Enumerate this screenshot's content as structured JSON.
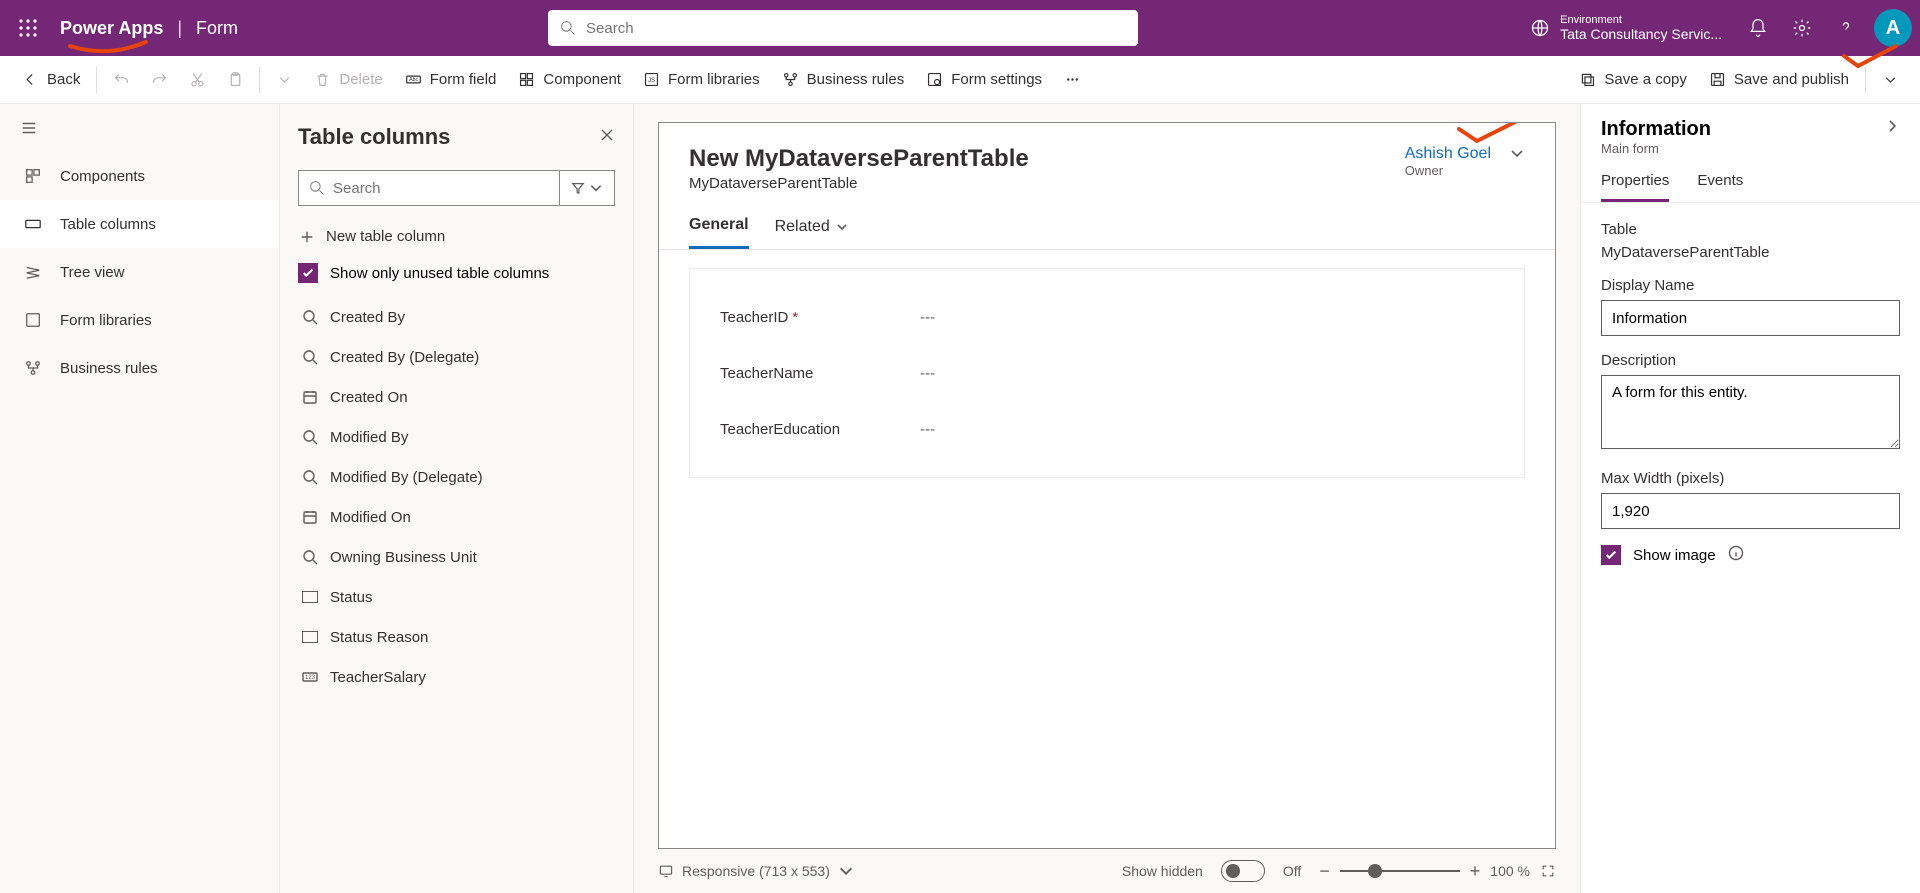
{
  "header": {
    "brand": "Power Apps",
    "context": "Form",
    "search_placeholder": "Search",
    "env_label": "Environment",
    "env_value": "Tata Consultancy Servic...",
    "avatar_letter": "A"
  },
  "cmdbar": {
    "back": "Back",
    "delete": "Delete",
    "form_field": "Form field",
    "component": "Component",
    "form_libraries": "Form libraries",
    "business_rules": "Business rules",
    "form_settings": "Form settings",
    "save_copy": "Save a copy",
    "save_publish": "Save and publish"
  },
  "leftnav": {
    "items": [
      {
        "label": "Components",
        "icon": "components"
      },
      {
        "label": "Table columns",
        "icon": "abc"
      },
      {
        "label": "Tree view",
        "icon": "layers"
      },
      {
        "label": "Form libraries",
        "icon": "js"
      },
      {
        "label": "Business rules",
        "icon": "rules"
      }
    ],
    "active_index": 1
  },
  "colpanel": {
    "title": "Table columns",
    "search_placeholder": "Search",
    "new_column": "New table column",
    "show_unused": "Show only unused table columns",
    "columns": [
      {
        "label": "Created By",
        "icon": "lookup"
      },
      {
        "label": "Created By (Delegate)",
        "icon": "lookup"
      },
      {
        "label": "Created On",
        "icon": "calendar"
      },
      {
        "label": "Modified By",
        "icon": "lookup"
      },
      {
        "label": "Modified By (Delegate)",
        "icon": "lookup"
      },
      {
        "label": "Modified On",
        "icon": "calendar"
      },
      {
        "label": "Owning Business Unit",
        "icon": "lookup"
      },
      {
        "label": "Status",
        "icon": "optionset"
      },
      {
        "label": "Status Reason",
        "icon": "optionset"
      },
      {
        "label": "TeacherSalary",
        "icon": "number"
      }
    ]
  },
  "form": {
    "title": "New MyDataverseParentTable",
    "subtitle": "MyDataverseParentTable",
    "owner_name": "Ashish Goel",
    "owner_label": "Owner",
    "tabs": {
      "general": "General",
      "related": "Related"
    },
    "fields": [
      {
        "label": "TeacherID",
        "required": true,
        "value": "---"
      },
      {
        "label": "TeacherName",
        "required": false,
        "value": "---"
      },
      {
        "label": "TeacherEducation",
        "required": false,
        "value": "---"
      }
    ]
  },
  "footer": {
    "responsive": "Responsive (713 x 553)",
    "show_hidden": "Show hidden",
    "toggle_label": "Off",
    "zoom": "100 %"
  },
  "properties": {
    "title": "Information",
    "subtitle": "Main form",
    "tabs": {
      "properties": "Properties",
      "events": "Events"
    },
    "table_lbl": "Table",
    "table_val": "MyDataverseParentTable",
    "display_lbl": "Display Name",
    "display_val": "Information",
    "desc_lbl": "Description",
    "desc_val": "A form for this entity.",
    "maxw_lbl": "Max Width (pixels)",
    "maxw_val": "1,920",
    "show_image": "Show image"
  }
}
